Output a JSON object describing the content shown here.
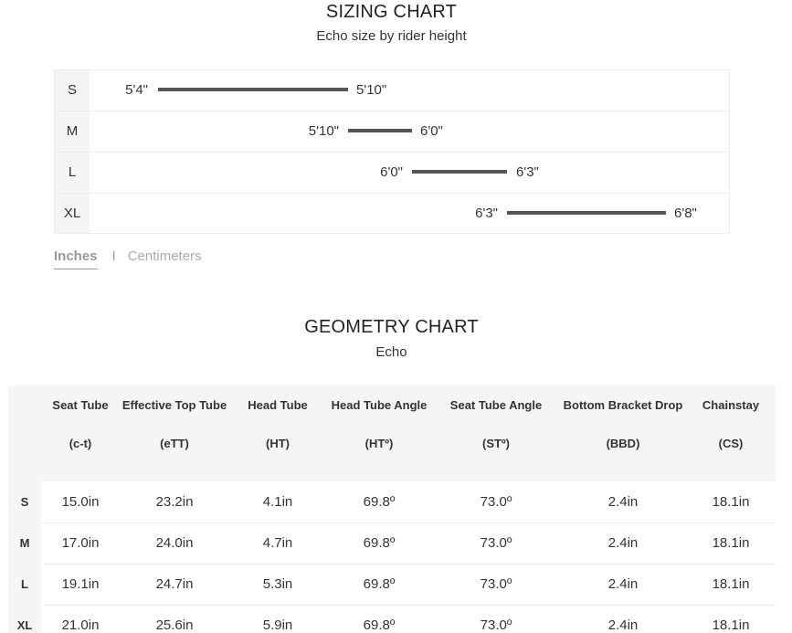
{
  "sizing": {
    "title": "SIZING CHART",
    "subtitle": "Echo size by rider height",
    "rows": [
      {
        "size": "S",
        "min": "5'4\"",
        "max": "5'10\""
      },
      {
        "size": "M",
        "min": "5'10\"",
        "max": "6'0\""
      },
      {
        "size": "L",
        "min": "6'0\"",
        "max": "6'3\""
      },
      {
        "size": "XL",
        "min": "6'3\"",
        "max": "6'8\""
      }
    ],
    "units": {
      "active": "Inches",
      "separator": "I",
      "inactive": "Centimeters"
    }
  },
  "geometry": {
    "title": "GEOMETRY CHART",
    "subtitle": "Echo",
    "columns": [
      {
        "name": "Seat Tube",
        "abbr": "(c-t)"
      },
      {
        "name": "Effective Top Tube",
        "abbr": "(eTT)"
      },
      {
        "name": "Head Tube",
        "abbr": "(HT)"
      },
      {
        "name": "Head Tube Angle",
        "abbr": "(HTº)"
      },
      {
        "name": "Seat Tube Angle",
        "abbr": "(STº)"
      },
      {
        "name": "Bottom Bracket Drop",
        "abbr": "(BBD)"
      },
      {
        "name": "Chainstay",
        "abbr": "(CS)"
      }
    ],
    "rows": [
      {
        "size": "S",
        "values": [
          "15.0in",
          "23.2in",
          "4.1in",
          "69.8º",
          "73.0º",
          "2.4in",
          "18.1in"
        ]
      },
      {
        "size": "M",
        "values": [
          "17.0in",
          "24.0in",
          "4.7in",
          "69.8º",
          "73.0º",
          "2.4in",
          "18.1in"
        ]
      },
      {
        "size": "L",
        "values": [
          "19.1in",
          "24.7in",
          "5.3in",
          "69.8º",
          "73.0º",
          "2.4in",
          "18.1in"
        ]
      },
      {
        "size": "XL",
        "values": [
          "21.0in",
          "25.6in",
          "5.9in",
          "69.8º",
          "73.0º",
          "2.4in",
          "18.1in"
        ]
      }
    ]
  },
  "colors": {
    "bar": "#555555",
    "label_background": "#f5f5f5"
  }
}
